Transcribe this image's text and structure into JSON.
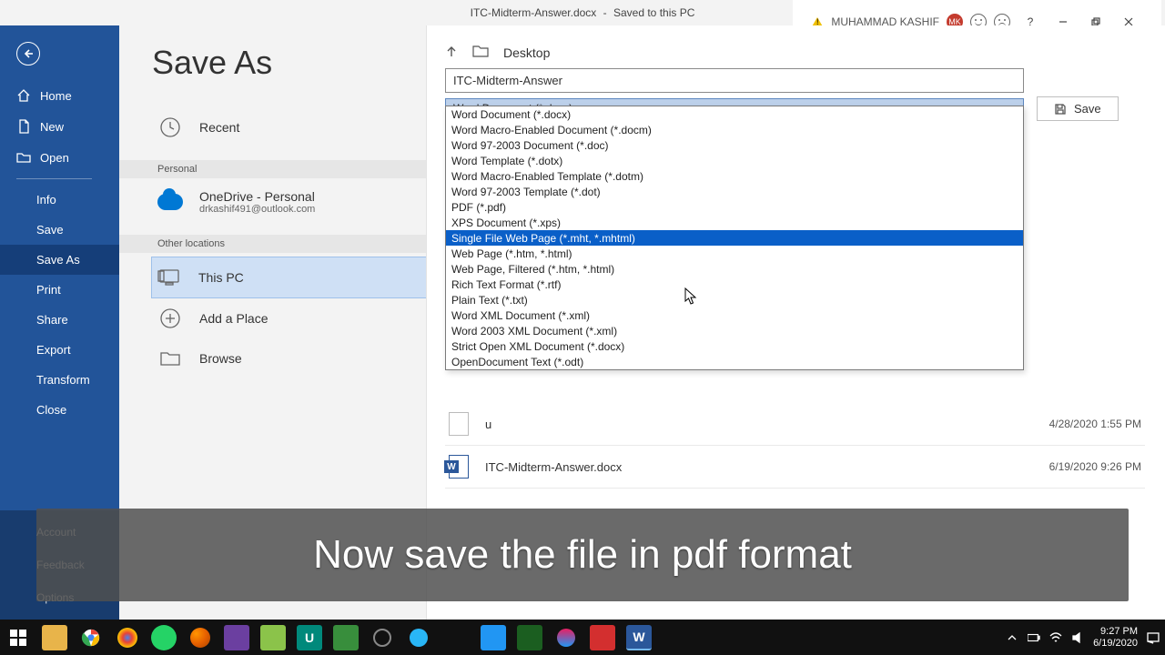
{
  "titlebar": {
    "doc": "ITC-Midterm-Answer.docx",
    "status": "Saved to this PC",
    "user": "MUHAMMAD KASHIF",
    "initials": "MK",
    "help": "?"
  },
  "nav": {
    "home": "Home",
    "new": "New",
    "open": "Open",
    "info": "Info",
    "save": "Save",
    "saveas": "Save As",
    "print": "Print",
    "share": "Share",
    "export": "Export",
    "transform": "Transform",
    "close": "Close",
    "account": "Account",
    "feedback": "Feedback",
    "options": "Options"
  },
  "mid": {
    "title": "Save As",
    "recent": "Recent",
    "personal_hdr": "Personal",
    "onedrive": "OneDrive - Personal",
    "onedrive_sub": "drkashif491@outlook.com",
    "other_hdr": "Other locations",
    "thispc": "This PC",
    "addplace": "Add a Place",
    "browse": "Browse"
  },
  "right": {
    "path": "Desktop",
    "filename": "ITC-Midterm-Answer",
    "selected_type": "Word Document (*.docx)",
    "save_label": "Save",
    "types": [
      "Word Document (*.docx)",
      "Word Macro-Enabled Document (*.docm)",
      "Word 97-2003 Document (*.doc)",
      "Word Template (*.dotx)",
      "Word Macro-Enabled Template (*.dotm)",
      "Word 97-2003 Template (*.dot)",
      "PDF (*.pdf)",
      "XPS Document (*.xps)",
      "Single File Web Page (*.mht, *.mhtml)",
      "Web Page (*.htm, *.html)",
      "Web Page, Filtered (*.htm, *.html)",
      "Rich Text Format (*.rtf)",
      "Plain Text (*.txt)",
      "Word XML Document (*.xml)",
      "Word 2003 XML Document (*.xml)",
      "Strict Open XML Document (*.docx)",
      "OpenDocument Text (*.odt)"
    ],
    "highlight_index": 8,
    "visible_file_name": "u",
    "visible_file_date": "4/28/2020 1:55 PM",
    "docx_name": "ITC-Midterm-Answer.docx",
    "docx_date": "6/19/2020 9:26 PM"
  },
  "caption": "Now save the file in pdf format",
  "tray": {
    "time": "9:27 PM",
    "date": "6/19/2020"
  }
}
